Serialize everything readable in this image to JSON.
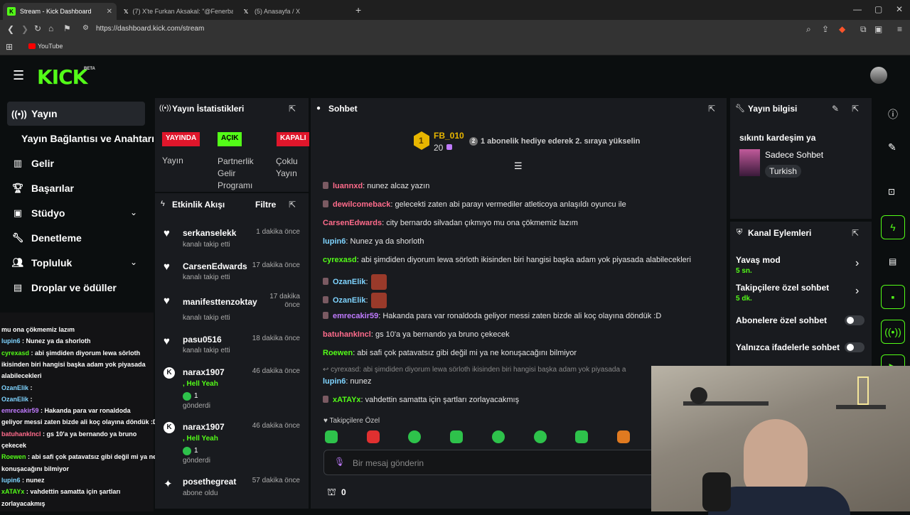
{
  "browser": {
    "tabs": [
      {
        "title": "Stream - Kick Dashboard",
        "active": true
      },
      {
        "title": "(7) X'te Furkan Aksakal: \"@Fenerbahç",
        "active": false
      },
      {
        "title": "(5) Anasayfa / X",
        "active": false
      }
    ],
    "new_tab": "+",
    "url": "https://dashboard.kick.com/stream",
    "bookmark": "YouTube"
  },
  "kick": {
    "logo": "KICK",
    "beta": "BETA"
  },
  "sidebar": {
    "items": [
      {
        "label": "Yayın",
        "icon": "broadcast-icon"
      },
      {
        "label": "Yayın Bağlantısı ve Anahtarı",
        "icon": ""
      },
      {
        "label": "Gelir",
        "icon": "chart-icon"
      },
      {
        "label": "Başarılar",
        "icon": "trophy-icon"
      },
      {
        "label": "Stüdyo",
        "icon": "studio-icon"
      },
      {
        "label": "Denetleme",
        "icon": "wrench-icon"
      },
      {
        "label": "Topluluk",
        "icon": "people-icon"
      },
      {
        "label": "Droplar ve ödüller",
        "icon": "gift-icon"
      }
    ]
  },
  "stats": {
    "title": "Yayın İstatistikleri",
    "badges": [
      {
        "badge": "YAYINDA",
        "label": "Yayın",
        "color": "#e0162b"
      },
      {
        "badge": "AÇIK",
        "label": "Partnerlik Gelir Programı",
        "color": "#53fc18"
      },
      {
        "badge": "KAPALI",
        "label": "Çoklu Yayın",
        "color": "#e0162b"
      }
    ]
  },
  "activity": {
    "title": "Etkinlik Akışı",
    "filter": "Filtre",
    "items": [
      {
        "name": "serkanselekk",
        "sub": "kanalı takip etti",
        "time": "1 dakika önce",
        "icon": "heart-icon"
      },
      {
        "name": "CarsenEdwards",
        "sub": "kanalı takip etti",
        "time": "17 dakika önce",
        "icon": "heart-icon"
      },
      {
        "name": "manifesttenzoktay",
        "sub": "kanalı takip etti",
        "time": "17 dakika önce",
        "icon": "heart-icon"
      },
      {
        "name": "pasu0516",
        "sub": "kanalı takip etti",
        "time": "18 dakika önce",
        "icon": "heart-icon"
      },
      {
        "name": "narax1907",
        "sub": ", Hell Yeah",
        "count": "1",
        "sub2": "gönderdi",
        "time": "46 dakika önce",
        "icon": "kick-icon"
      },
      {
        "name": "narax1907",
        "sub": ", Hell Yeah",
        "count": "1",
        "sub2": "gönderdi",
        "time": "46 dakika önce",
        "icon": "kick-icon"
      },
      {
        "name": "posethegreat",
        "sub": "abone oldu",
        "time": "57 dakika önce",
        "icon": "sparkle-icon"
      }
    ]
  },
  "chat": {
    "title": "Sohbet",
    "leader": {
      "rank": "1",
      "name": "FB_010",
      "count": "20"
    },
    "gift_badge": "2",
    "gift_text": "1 abonelik hediye ederek 2. sıraya yükselin",
    "messages": [
      {
        "user": "luannxd",
        "text": ": nunez alcaz yazın",
        "color": "#ff6b8b",
        "badge": true
      },
      {
        "user": "dewilcomeback",
        "text": ": gelecekti zaten abi parayı vermediler atleticoya anlaşıldı oyuncu ile",
        "color": "#ff6b8b",
        "badge": true
      },
      {
        "user": "CarsenEdwards",
        "text": ": city bernardo silvadan çıkmıyo mu ona çökmemiz lazım",
        "color": "#ff6b8b",
        "badge": false
      },
      {
        "user": "lupin6",
        "text": ": Nunez ya da shorloth",
        "color": "#7fd4ff",
        "badge": false
      },
      {
        "user": "cyrexasd",
        "text": ": abi şimdiden diyorum lewa sörloth ikisinden biri hangisi başka adam yok piyasada alabilecekleri",
        "color": "#53fc18",
        "badge": false
      },
      {
        "user": "OzanElik",
        "text": ":",
        "color": "#7fd4ff",
        "badge": true
      },
      {
        "user": "OzanElik",
        "text": ":",
        "color": "#7fd4ff",
        "badge": true
      },
      {
        "user": "emrecakir59",
        "text": ": Hakanda para var ronaldoda geliyor messi zaten bizde ali koç olayına döndük :D",
        "color": "#c07bff",
        "badge": true
      },
      {
        "user": "batuhankIncl",
        "text": ": gs 10'a ya bernando ya bruno çekecek",
        "color": "#ff6b8b",
        "badge": false
      },
      {
        "user": "Roewen",
        "text": ": abi safi çok patavatsız gibi değil mi ya ne konuşacağını bilmiyor",
        "color": "#53fc18",
        "badge": false
      }
    ],
    "reply_ref": "cyrexasd: abi şimdiden diyorum lewa sörloth ikisinden biri hangisi başka adam yok piyasada a",
    "messages2": [
      {
        "user": "lupin6",
        "text": ": nunez",
        "color": "#7fd4ff",
        "badge": false
      },
      {
        "user": "xATAYx",
        "text": ": vahdettin samatta için şartları zorlayacakmış",
        "color": "#53fc18",
        "badge": true
      }
    ],
    "followers_only": "Takipçilere Özel",
    "input_placeholder": "Bir mesaj gönderin",
    "points": "0"
  },
  "stream_info": {
    "title": "Yayın bilgisi",
    "stream_title": "sıkıntı kardeşim ya",
    "category": "Sadece Sohbet",
    "language": "Turkish"
  },
  "channel_actions": {
    "title": "Kanal Eylemleri",
    "items": [
      {
        "label": "Yavaş mod",
        "value": "5 sn."
      },
      {
        "label": "Takipçilere özel sohbet",
        "value": "5 dk."
      }
    ],
    "toggles": [
      {
        "label": "Abonelere özel sohbet"
      },
      {
        "label": "Yalnızca ifadelerle sohbet"
      }
    ]
  },
  "overlay_chat": [
    {
      "user": "",
      "text": "mu ona çökmemiz lazım",
      "color": "#fff"
    },
    {
      "user": "lupin6",
      "text": " : Nunez ya da shorloth",
      "color": "#7fd4ff"
    },
    {
      "user": "cyrexasd",
      "text": " : abi şimdiden diyorum lewa sörloth",
      "color": "#53fc18"
    },
    {
      "user": "",
      "text": "ikisinden biri hangisi başka adam yok piyasada",
      "color": "#fff"
    },
    {
      "user": "",
      "text": "alabilecekleri",
      "color": "#fff"
    },
    {
      "user": "OzanElik",
      "text": " :",
      "color": "#7fd4ff"
    },
    {
      "user": "OzanElik",
      "text": " :",
      "color": "#7fd4ff"
    },
    {
      "user": "emrecakir59",
      "text": " : Hakanda para var ronaldoda",
      "color": "#c07bff"
    },
    {
      "user": "",
      "text": "geliyor messi zaten bizde ali koç olayına döndük :D",
      "color": "#fff"
    },
    {
      "user": "batuhankIncl",
      "text": " : gs 10'a ya bernando ya bruno",
      "color": "#ff6b8b"
    },
    {
      "user": "",
      "text": "çekecek",
      "color": "#fff"
    },
    {
      "user": "Roewen",
      "text": " : abi safi çok patavatsız gibi değil mi ya ne",
      "color": "#53fc18"
    },
    {
      "user": "",
      "text": "konuşacağını bilmiyor",
      "color": "#fff"
    },
    {
      "user": "lupin6",
      "text": " : nunez",
      "color": "#7fd4ff"
    },
    {
      "user": "xATAYx",
      "text": " : vahdettin samatta için şartları",
      "color": "#53fc18"
    },
    {
      "user": "",
      "text": "zorlayacakmış",
      "color": "#fff"
    }
  ],
  "colors": {
    "accent": "#53fc18",
    "live": "#e0162b",
    "panel": "#191b1f",
    "bg": "#0b0e0f"
  }
}
